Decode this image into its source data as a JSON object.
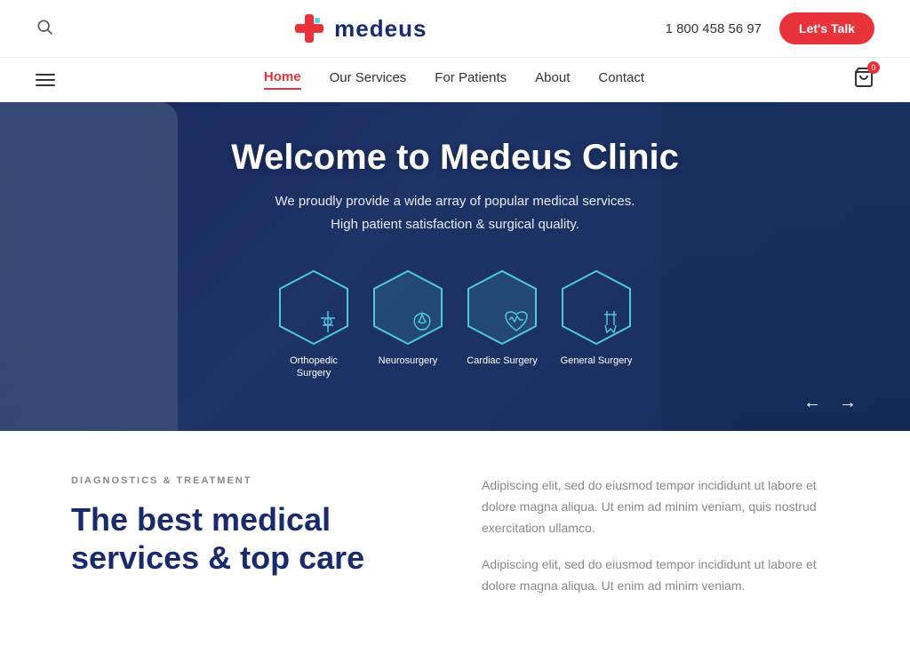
{
  "topbar": {
    "search_icon": "🔍",
    "logo_text": "medeus",
    "phone": "1 800 458 56 97",
    "lets_talk_label": "Let's Talk"
  },
  "nav": {
    "links": [
      {
        "label": "Home",
        "active": true
      },
      {
        "label": "Our Services",
        "active": false
      },
      {
        "label": "For Patients",
        "active": false
      },
      {
        "label": "About",
        "active": false
      },
      {
        "label": "Contact",
        "active": false
      }
    ],
    "cart_count": "0"
  },
  "hero": {
    "title": "Welcome to Medeus Clinic",
    "subtitle_line1": "We proudly provide a wide array of popular medical services.",
    "subtitle_line2": "High patient satisfaction & surgical quality.",
    "services": [
      {
        "label": "Orthopedic\nSurgery",
        "icon": "✦"
      },
      {
        "label": "Neurosurgery",
        "icon": "⬡"
      },
      {
        "label": "Cardiac Surgery",
        "icon": "♡"
      },
      {
        "label": "General Surgery",
        "icon": "✂"
      }
    ]
  },
  "lower": {
    "tag": "DIAGNOSTICS & TREATMENT",
    "heading_line1": "The best medical",
    "heading_line2": "services & top care",
    "para1": "Adipiscing elit, sed do eiusmod tempor incididunt ut labore et dolore magna aliqua. Ut enim ad minim veniam, quis nostrud exercitation ullamco.",
    "para2": "Adipiscing elit, sed do eiusmod tempor incididunt ut labore et dolore magna aliqua. Ut enim ad minim veniam."
  }
}
